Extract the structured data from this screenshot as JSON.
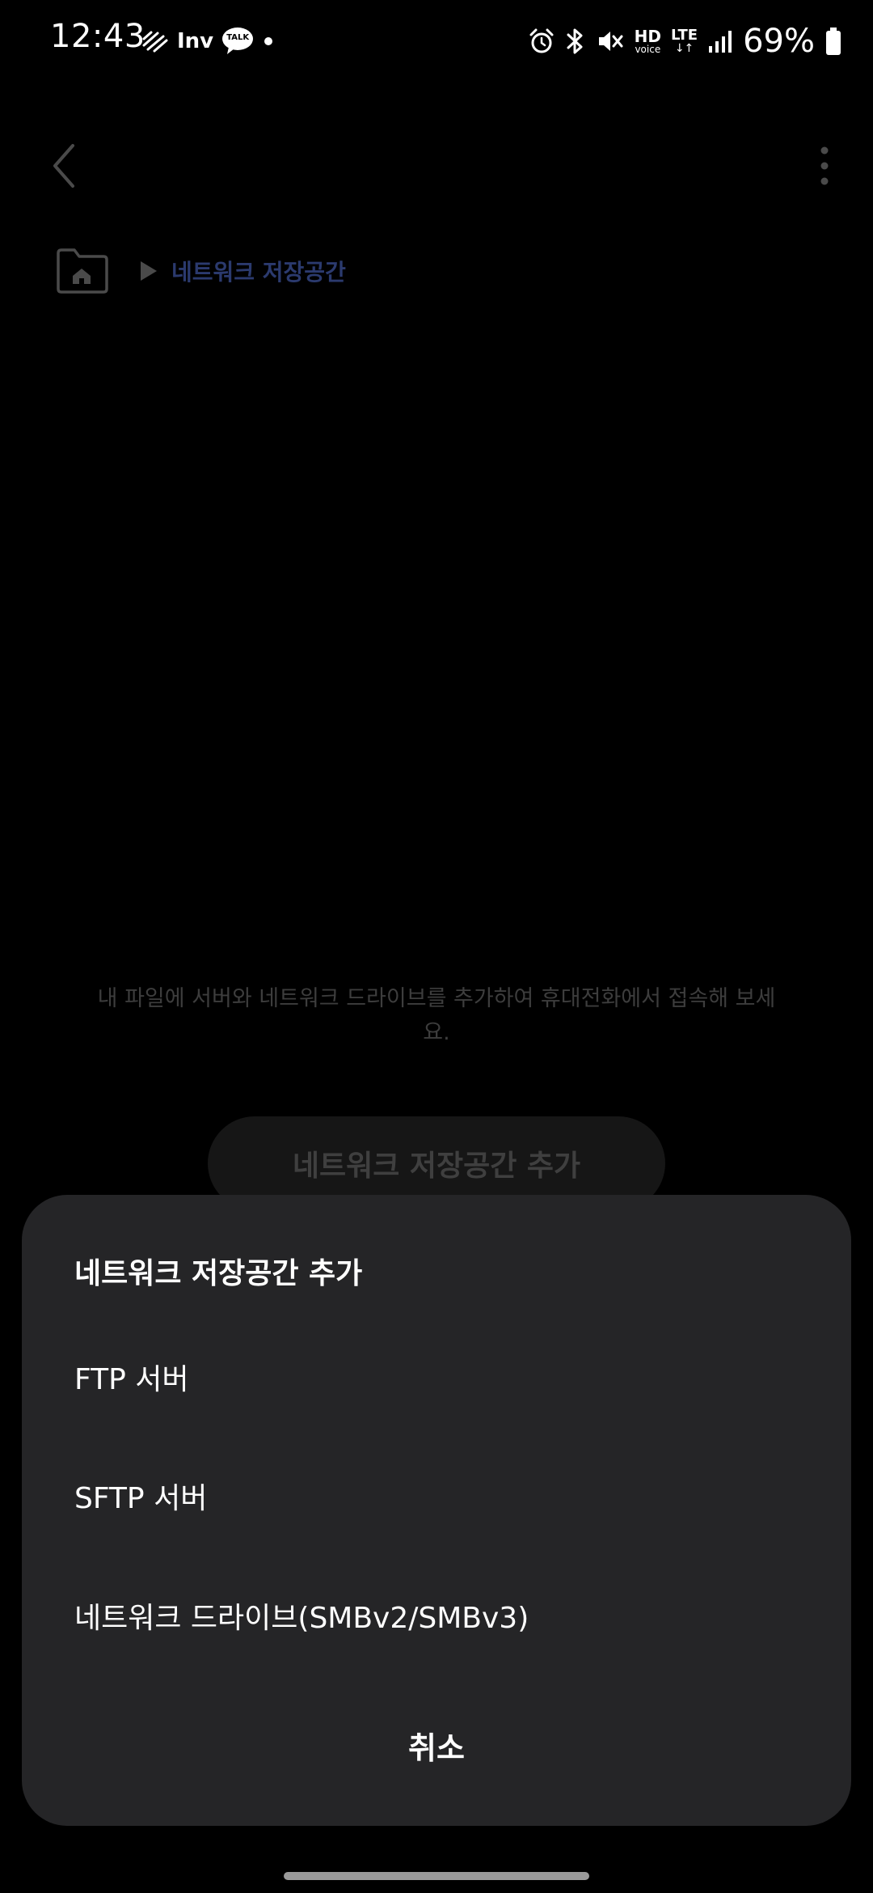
{
  "status_bar": {
    "time": "12:43",
    "battery_percent": "69%",
    "left_icons": [
      "activity-icon",
      "inv-icon",
      "kakaotalk-icon",
      "dot-icon"
    ],
    "right_icons": [
      "alarm-icon",
      "bluetooth-icon",
      "mute-icon",
      "hd-voice-icon",
      "lte-icon",
      "signal-icon",
      "battery-icon"
    ],
    "inv_label": "Inv",
    "talk_label": "TALK",
    "hd_label": "HD",
    "voice_label": "voice",
    "lte_label": "LTE"
  },
  "app": {
    "breadcrumb_label": "네트워크 저장공간",
    "empty_description": "내 파일에 서버와 네트워크 드라이브를 추가하여 휴대전화에서 접속해 보세요.",
    "add_button_label": "네트워크 저장공간 추가"
  },
  "sheet": {
    "title": "네트워크 저장공간 추가",
    "items": [
      {
        "label": "FTP 서버"
      },
      {
        "label": "SFTP 서버"
      },
      {
        "label": "네트워크 드라이브(SMBv2/SMBv3)"
      }
    ],
    "cancel_label": "취소"
  },
  "colors": {
    "background": "#000000",
    "sheet_background": "#252527",
    "breadcrumb_accent": "#2b3a6e",
    "dimmed_text": "#3d3d3d"
  }
}
